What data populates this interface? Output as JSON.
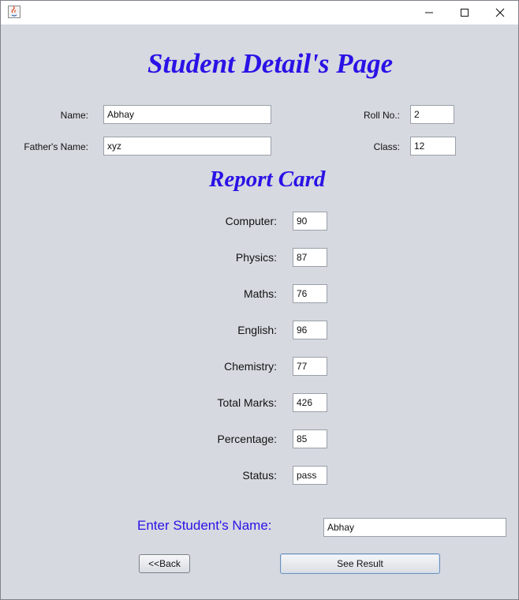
{
  "window": {
    "controls": {
      "minimize": "—",
      "maximize": "☐",
      "close": "✕"
    }
  },
  "header": {
    "title": "Student Detail's Page"
  },
  "student": {
    "name_label": "Name:",
    "name_value": "Abhay",
    "father_label": "Father's Name:",
    "father_value": "xyz",
    "roll_label": "Roll No.:",
    "roll_value": "2",
    "class_label": "Class:",
    "class_value": "12"
  },
  "report": {
    "title": "Report Card",
    "rows": [
      {
        "label": "Computer:",
        "value": "90"
      },
      {
        "label": "Physics:",
        "value": "87"
      },
      {
        "label": "Maths:",
        "value": "76"
      },
      {
        "label": "English:",
        "value": "96"
      },
      {
        "label": "Chemistry:",
        "value": "77"
      },
      {
        "label": "Total Marks:",
        "value": "426"
      },
      {
        "label": "Percentage:",
        "value": "85"
      },
      {
        "label": "Status:",
        "value": "pass"
      }
    ]
  },
  "search": {
    "prompt": "Enter Student's Name:",
    "value": "Abhay"
  },
  "buttons": {
    "back": "<<Back",
    "see_result": "See Result"
  },
  "colors": {
    "accent": "#2a12e6",
    "background": "#d6d9e0"
  }
}
